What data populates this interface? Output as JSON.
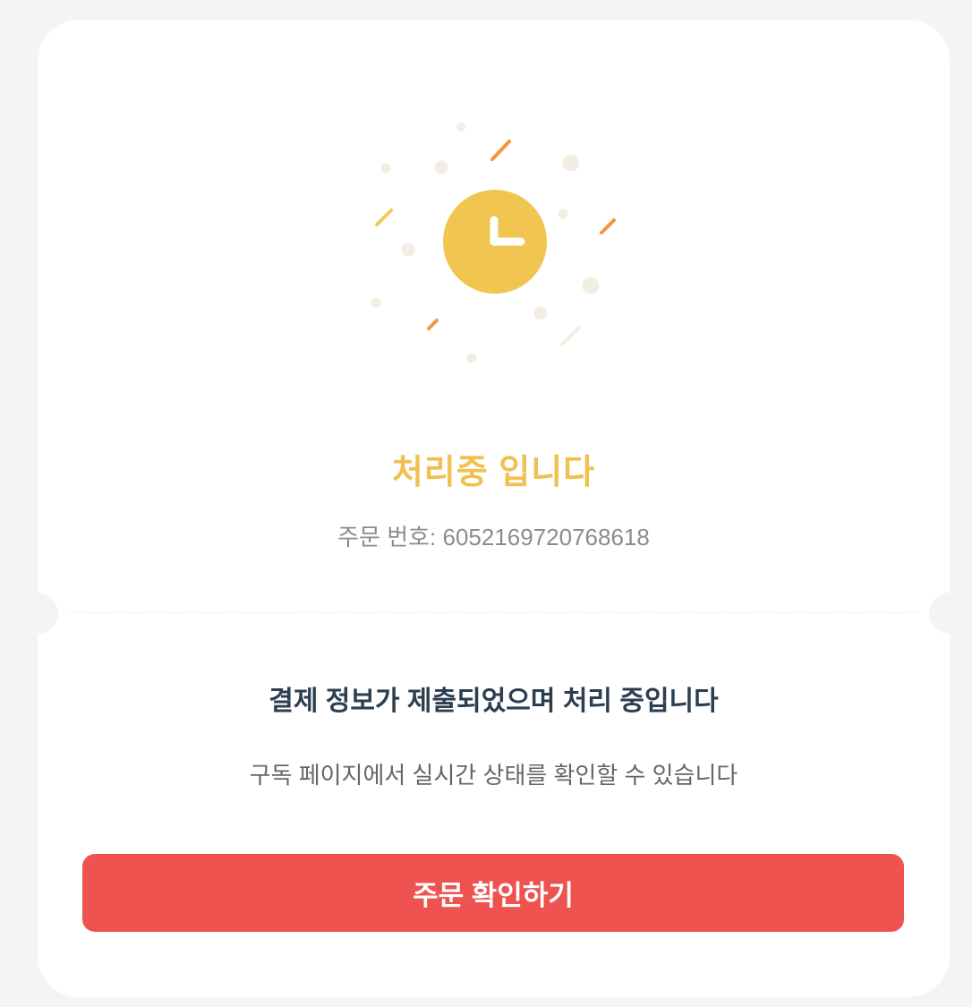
{
  "status": {
    "icon": "clock-icon",
    "title": "처리중 입니다",
    "order_number": "주문 번호: 6052169720768618"
  },
  "message": {
    "title": "결제 정보가 제출되었으며 처리 중입니다",
    "description": "구독 페이지에서 실시간 상태를 확인할 수 있습니다"
  },
  "actions": {
    "confirm_label": "주문 확인하기"
  },
  "colors": {
    "accent": "#f0c150",
    "button": "#ee5350",
    "spark_orange": "#f5953a",
    "spark_yellow": "#f3c957",
    "dot": "#f3eee2",
    "background": "#f4f4f4"
  }
}
